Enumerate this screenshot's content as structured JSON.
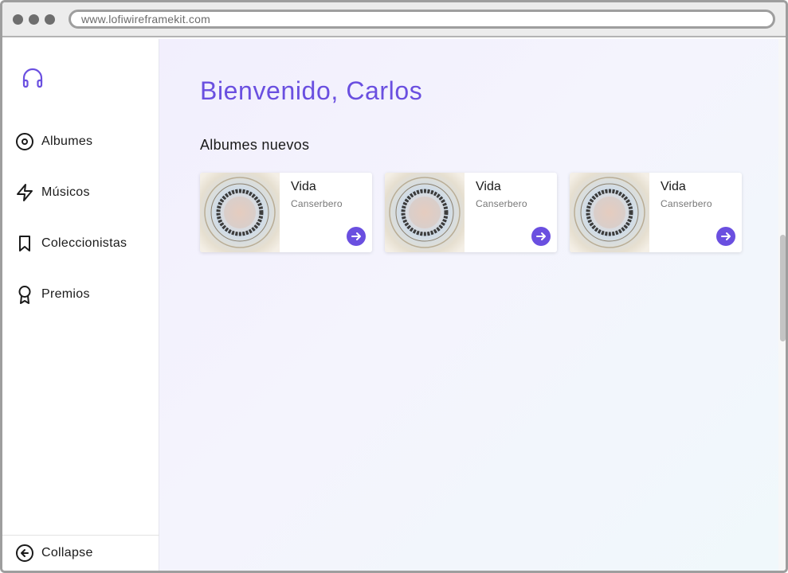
{
  "browser": {
    "url": "www.lofiwireframekit.com"
  },
  "sidebar": {
    "logo_icon": "headphones-icon",
    "items": [
      {
        "label": "Albumes",
        "icon": "disc-icon"
      },
      {
        "label": "Músicos",
        "icon": "lightning-icon"
      },
      {
        "label": "Coleccionistas",
        "icon": "bookmark-icon"
      },
      {
        "label": "Premios",
        "icon": "award-icon"
      }
    ],
    "collapse": {
      "label": "Collapse",
      "icon": "arrow-left-circle-icon"
    }
  },
  "main": {
    "welcome": "Bienvenido, Carlos",
    "section_title": "Albumes nuevos",
    "albums": [
      {
        "title": "Vida",
        "artist": "Canserbero",
        "action_icon": "arrow-right-circle-icon"
      },
      {
        "title": "Vida",
        "artist": "Canserbero",
        "action_icon": "arrow-right-circle-icon"
      },
      {
        "title": "Vida",
        "artist": "Canserbero",
        "action_icon": "arrow-right-circle-icon"
      }
    ]
  },
  "colors": {
    "accent": "#6a4fe0",
    "text": "#1a1a1a",
    "muted": "#777777"
  }
}
